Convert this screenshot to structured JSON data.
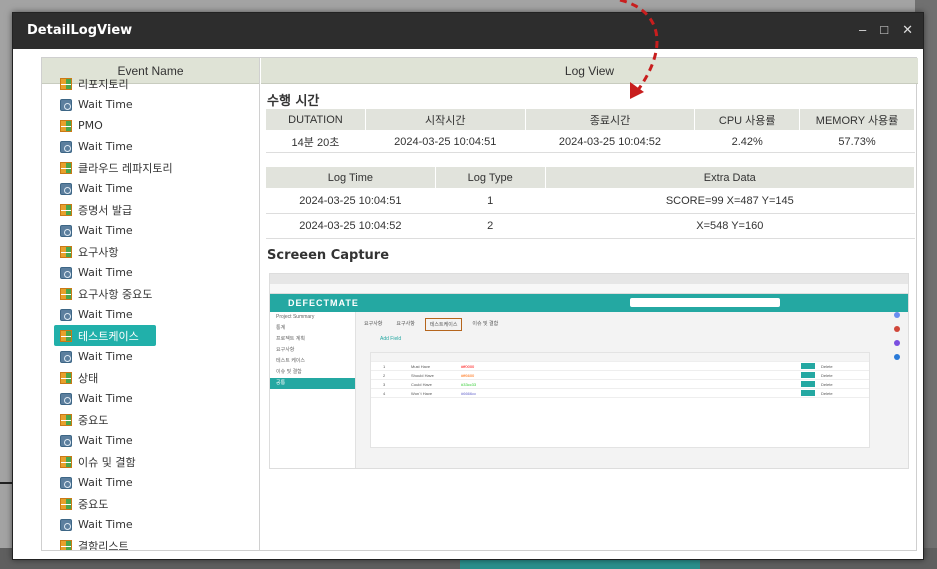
{
  "window": {
    "title": "DetailLogView",
    "controls": [
      "–",
      "□",
      "✕"
    ]
  },
  "left_panel": {
    "header": "Event Name",
    "items": [
      {
        "label": "리포지토리",
        "icon": "grid"
      },
      {
        "label": "Wait Time",
        "icon": "wait"
      },
      {
        "label": "PMO",
        "icon": "grid"
      },
      {
        "label": "Wait Time",
        "icon": "wait"
      },
      {
        "label": "클라우드 레파지토리",
        "icon": "grid"
      },
      {
        "label": "Wait Time",
        "icon": "wait"
      },
      {
        "label": "증명서 발급",
        "icon": "grid"
      },
      {
        "label": "Wait Time",
        "icon": "wait"
      },
      {
        "label": "요구사항",
        "icon": "grid"
      },
      {
        "label": "Wait Time",
        "icon": "wait"
      },
      {
        "label": "요구사항 중요도",
        "icon": "grid"
      },
      {
        "label": "Wait Time",
        "icon": "wait"
      },
      {
        "label": "테스트케이스",
        "icon": "grid",
        "selected": true
      },
      {
        "label": "Wait Time",
        "icon": "wait"
      },
      {
        "label": "상태",
        "icon": "grid"
      },
      {
        "label": "Wait Time",
        "icon": "wait"
      },
      {
        "label": "중요도",
        "icon": "grid"
      },
      {
        "label": "Wait Time",
        "icon": "wait"
      },
      {
        "label": "이슈 및 결함",
        "icon": "grid"
      },
      {
        "label": "Wait Time",
        "icon": "wait"
      },
      {
        "label": "중요도",
        "icon": "grid"
      },
      {
        "label": "Wait Time",
        "icon": "wait"
      },
      {
        "label": "결함리스트",
        "icon": "grid"
      }
    ]
  },
  "right_panel": {
    "header": "Log View",
    "exec_time": {
      "title": "수행 시간",
      "columns": [
        "DUTATION",
        "시작시간",
        "종료시간",
        "CPU 사용률",
        "MEMORY 사용률"
      ],
      "row": [
        "14분 20초",
        "2024-03-25 10:04:51",
        "2024-03-25 10:04:52",
        "2.42%",
        "57.73%"
      ]
    },
    "log_table": {
      "columns": [
        "Log Time",
        "Log Type",
        "Extra Data"
      ],
      "rows": [
        [
          "2024-03-25 10:04:51",
          "1",
          "SCORE=99 X=487 Y=145"
        ],
        [
          "2024-03-25 10:04:52",
          "2",
          "X=548 Y=160"
        ]
      ]
    },
    "screen_capture": {
      "title": "Screeen Capture",
      "app_name": "DEFECTMATE",
      "sidebar": [
        "Project Summary",
        "통계",
        "프로젝트 계획",
        "요구사항",
        "테스트 케이스",
        "이슈 및 결함",
        "공통"
      ],
      "page_tabs": [
        "요구사항",
        "요구사항",
        "테스트케이스",
        "이슈 및 결함"
      ],
      "table_rows": [
        {
          "no": "1",
          "name": "Must Have",
          "color": "#ff0000"
        },
        {
          "no": "2",
          "name": "Should Have",
          "color": "#ff6600"
        },
        {
          "no": "3",
          "name": "Could Have",
          "color": "#33cc33"
        },
        {
          "no": "4",
          "name": "Won`t Have",
          "color": "#6666cc"
        }
      ],
      "edit_label": "Edit",
      "delete_label": "Delete",
      "add_field_label": "Add Field"
    }
  },
  "colors": {
    "accent": "#21b0aa",
    "header_bg": "#dfe3d6",
    "titlebar": "#2d2d2d"
  }
}
